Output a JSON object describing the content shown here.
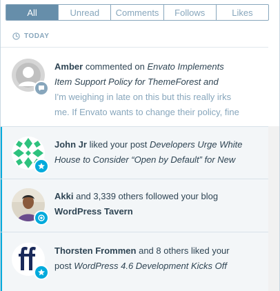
{
  "tabs": [
    {
      "label": "All",
      "active": true
    },
    {
      "label": "Unread",
      "active": false
    },
    {
      "label": "Comments",
      "active": false
    },
    {
      "label": "Follows",
      "active": false
    },
    {
      "label": "Likes",
      "active": false
    }
  ],
  "section": {
    "label": "TODAY",
    "icon": "clock-icon"
  },
  "notes": [
    {
      "actor": "Amber",
      "action": "commented on",
      "target": "Envato Implements Item Support Policy for ThemeForest and",
      "excerpt": "I'm weighing in late on this but this really irks me. If Envato wants to change their policy, fine",
      "line1_target": "Envato Implements",
      "line2_target": "Item Support Policy for ThemeForest and",
      "excerpt_line1": "I'm weighing in late on this but this really irks",
      "excerpt_line2": "me. If Envato wants to change their policy, fine",
      "badge_icon": "comment-icon"
    },
    {
      "actor": "John Jr",
      "action": "liked your post",
      "target_line1": "Developers Urge White",
      "target_line2": "House to Consider “Open by Default” for New",
      "badge_icon": "star-icon"
    },
    {
      "actor": "Akki",
      "action": "and 3,339 others followed your blog",
      "blog": "WordPress Tavern",
      "badge_icon": "follow-icon"
    },
    {
      "actor": "Thorsten Frommen",
      "action": "and 8 others liked your",
      "action2": "post",
      "target": "WordPress 4.6 Development Kicks Off",
      "badge_icon": "star-icon"
    }
  ]
}
